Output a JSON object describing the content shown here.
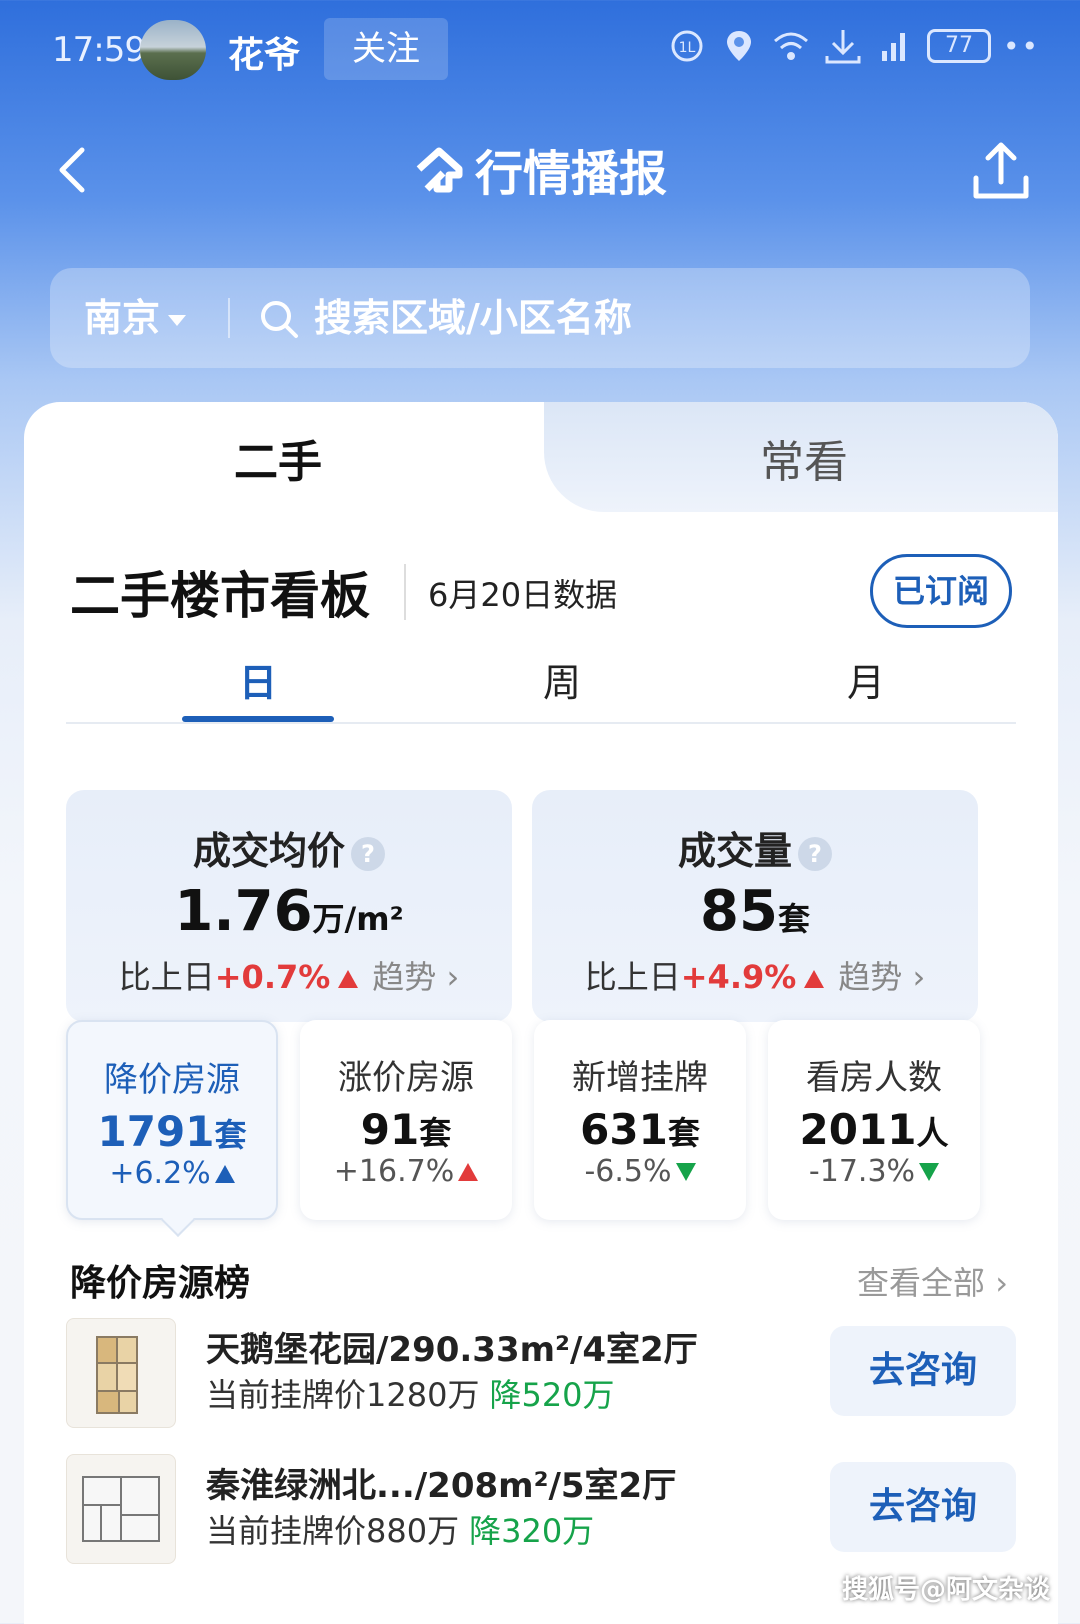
{
  "status_bar": {
    "time": "17:59",
    "username": "花爷",
    "follow_label": "关注",
    "battery": "77",
    "icons": [
      "volte-icon",
      "location-icon",
      "wifi-icon",
      "download-icon",
      "signal-icon",
      "battery-icon"
    ]
  },
  "header": {
    "title": "行情播报",
    "back_icon": "chevron-left-icon",
    "share_icon": "share-upload-icon"
  },
  "search": {
    "city": "南京",
    "placeholder": "搜索区域/小区名称"
  },
  "top_tabs": [
    {
      "label": "二手",
      "active": true
    },
    {
      "label": "常看",
      "active": false
    }
  ],
  "board": {
    "title": "二手楼市看板",
    "date": "6月20日数据",
    "subscribe_label": "已订阅"
  },
  "period_tabs": [
    {
      "label": "日",
      "active": true
    },
    {
      "label": "周",
      "active": false
    },
    {
      "label": "月",
      "active": false
    }
  ],
  "stats": [
    {
      "label": "成交均价",
      "value": "1.76",
      "unit": "万/m²",
      "compare_prefix": "比上日",
      "change": "+0.7%",
      "trend_label": "趋势"
    },
    {
      "label": "成交量",
      "value": "85",
      "unit": "套",
      "compare_prefix": "比上日",
      "change": "+4.9%",
      "trend_label": "趋势"
    }
  ],
  "mini_stats": [
    {
      "label": "降价房源",
      "value": "1791",
      "unit": "套",
      "change": "+6.2%",
      "direction": "up"
    },
    {
      "label": "涨价房源",
      "value": "91",
      "unit": "套",
      "change": "+16.7%",
      "direction": "up"
    },
    {
      "label": "新增挂牌",
      "value": "631",
      "unit": "套",
      "change": "-6.5%",
      "direction": "down"
    },
    {
      "label": "看房人数",
      "value": "2011",
      "unit": "人",
      "change": "-17.3%",
      "direction": "down"
    }
  ],
  "list": {
    "title": "降价房源榜",
    "view_all": "查看全部",
    "items": [
      {
        "title": "天鹅堡花园/290.33m²/4室2厅",
        "price_prefix": "当前挂牌价1280万",
        "drop": "降520万",
        "button": "去咨询"
      },
      {
        "title": "秦淮绿洲北.../208m²/5室2厅",
        "price_prefix": "当前挂牌价880万",
        "drop": "降320万",
        "button": "去咨询"
      }
    ]
  },
  "watermark": "搜狐号@阿文杂谈",
  "colors": {
    "accent": "#1d5fb8",
    "up": "#e23b3b",
    "down": "#16a34a",
    "header_bg": "#2f6fdc"
  }
}
